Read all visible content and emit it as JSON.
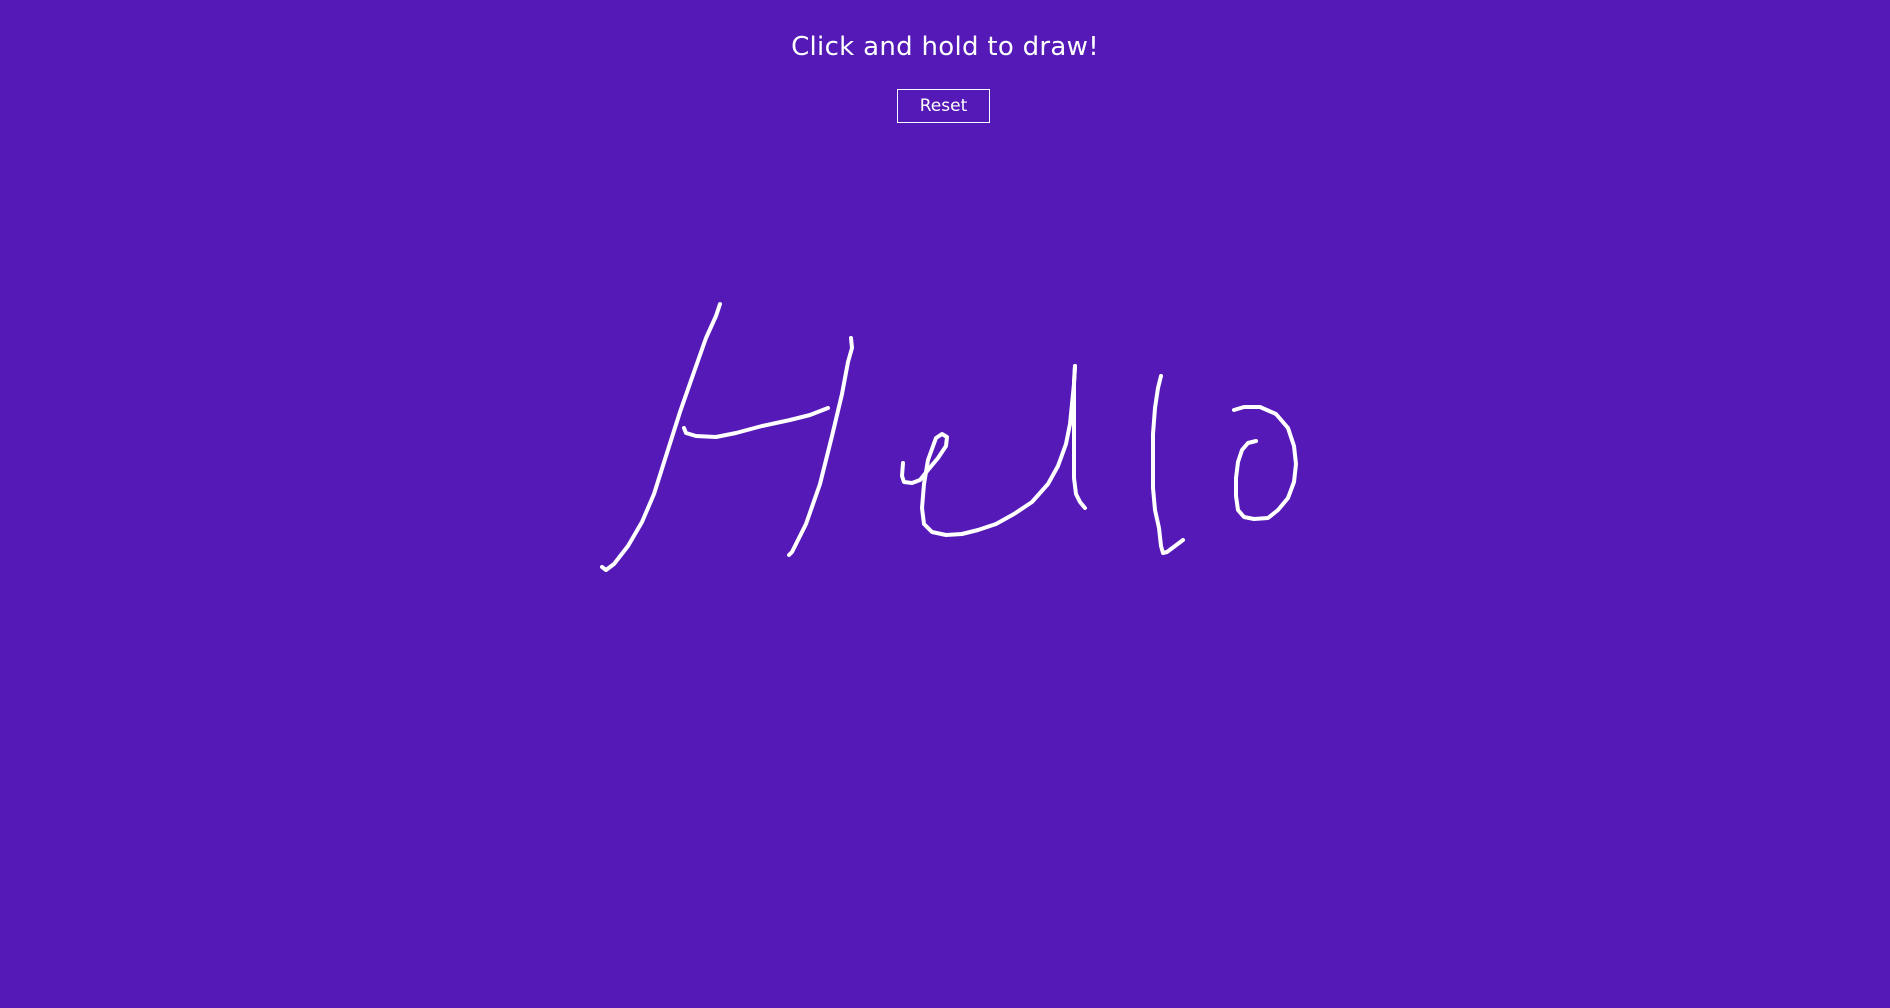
{
  "header": {
    "instructions": "Click and hold to draw!"
  },
  "controls": {
    "reset_label": "Reset"
  },
  "canvas": {
    "stroke_color": "#ffffff",
    "background_color": "#5419b6"
  }
}
